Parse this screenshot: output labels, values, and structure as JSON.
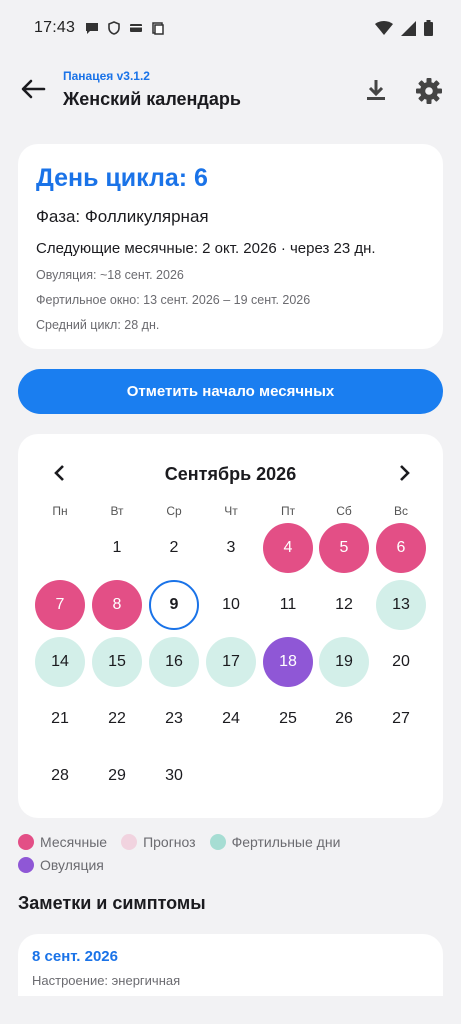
{
  "status_bar": {
    "time": "17:43",
    "left_icons": [
      "chat-icon",
      "shield-icon",
      "card-icon",
      "copy-icon"
    ],
    "right_icons": [
      "wifi-icon",
      "signal-icon",
      "battery-icon"
    ]
  },
  "app_bar": {
    "subtitle": "Панацея v3.1.2",
    "title": "Женский календарь",
    "icons": [
      "back-arrow-icon",
      "download-icon",
      "gear-icon"
    ]
  },
  "cycle": {
    "day_label": "День цикла: 6",
    "phase": "Фаза: Фолликулярная",
    "next_period": "Следующие месячные: 2 окт. 2026 · через 23 дн.",
    "ovulation": "Овуляция: ~18 сент. 2026",
    "fertile_window": "Фертильное окно: 13 сент. 2026 – 19 сент. 2026",
    "avg_cycle": "Средний цикл: 28 дн."
  },
  "mark_button": "Отметить начало месячных",
  "calendar": {
    "month": "Сентябрь 2026",
    "weekdays": [
      "Пн",
      "Вт",
      "Ср",
      "Чт",
      "Пт",
      "Сб",
      "Вс"
    ],
    "days": [
      {
        "n": "1",
        "state": "normal"
      },
      {
        "n": "2",
        "state": "normal"
      },
      {
        "n": "3",
        "state": "normal"
      },
      {
        "n": "4",
        "state": "period"
      },
      {
        "n": "5",
        "state": "period"
      },
      {
        "n": "6",
        "state": "period"
      },
      {
        "n": "7",
        "state": "period"
      },
      {
        "n": "8",
        "state": "period"
      },
      {
        "n": "9",
        "state": "today"
      },
      {
        "n": "10",
        "state": "normal"
      },
      {
        "n": "11",
        "state": "normal"
      },
      {
        "n": "12",
        "state": "normal"
      },
      {
        "n": "13",
        "state": "fertile"
      },
      {
        "n": "14",
        "state": "fertile"
      },
      {
        "n": "15",
        "state": "fertile"
      },
      {
        "n": "16",
        "state": "fertile"
      },
      {
        "n": "17",
        "state": "fertile"
      },
      {
        "n": "18",
        "state": "ovulation"
      },
      {
        "n": "19",
        "state": "fertile"
      },
      {
        "n": "20",
        "state": "normal"
      },
      {
        "n": "21",
        "state": "normal"
      },
      {
        "n": "22",
        "state": "normal"
      },
      {
        "n": "23",
        "state": "normal"
      },
      {
        "n": "24",
        "state": "normal"
      },
      {
        "n": "25",
        "state": "normal"
      },
      {
        "n": "26",
        "state": "normal"
      },
      {
        "n": "27",
        "state": "normal"
      },
      {
        "n": "28",
        "state": "normal"
      },
      {
        "n": "29",
        "state": "normal"
      },
      {
        "n": "30",
        "state": "normal"
      }
    ]
  },
  "legend": {
    "period": "Месячные",
    "forecast": "Прогноз",
    "fertile": "Фертильные дни",
    "ovulation": "Овуляция"
  },
  "colors": {
    "accent": "#1a73e8",
    "period": "#e34f86",
    "forecast": "#f1d3df",
    "fertile": "#a6ddd3",
    "ovulation": "#8f57d6"
  },
  "notes": {
    "section_title": "Заметки и симптомы",
    "items": [
      {
        "date": "8 сент. 2026",
        "text": "Настроение: энергичная"
      }
    ]
  }
}
